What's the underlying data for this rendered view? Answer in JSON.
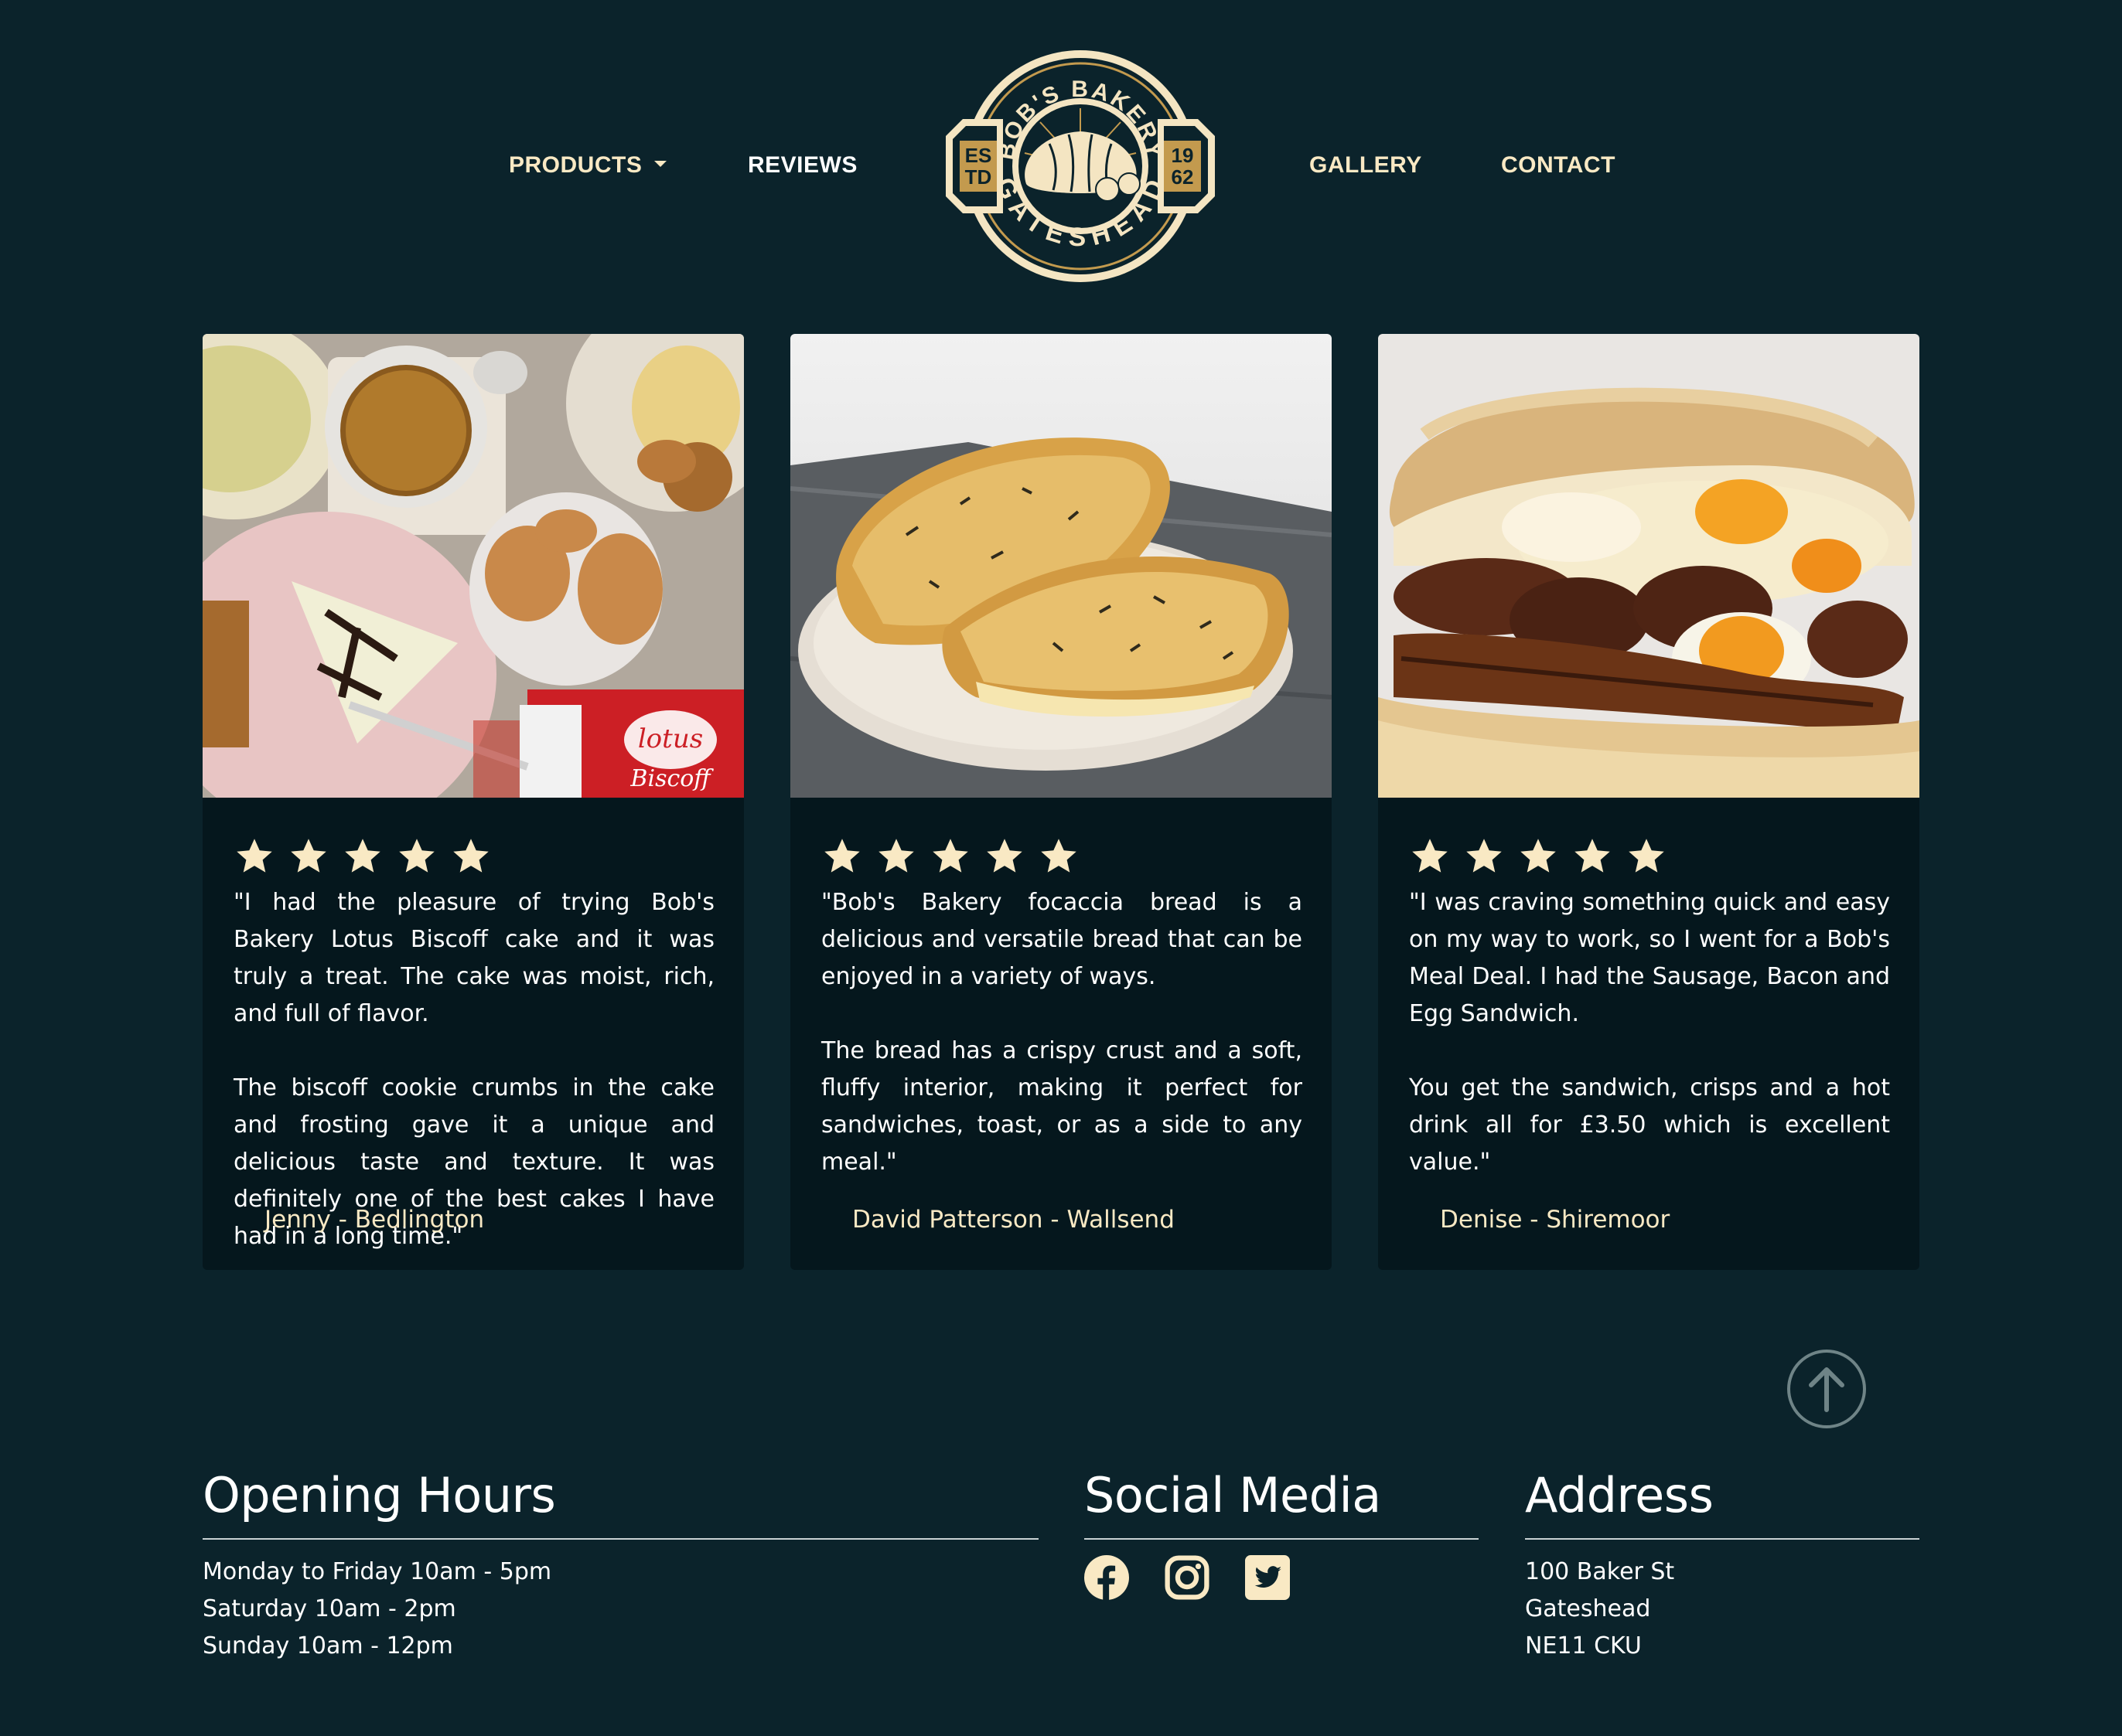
{
  "nav": {
    "products": "PRODUCTS",
    "reviews": "REVIEWS",
    "gallery": "GALLERY",
    "contact": "CONTACT"
  },
  "logo": {
    "top_text": "BOB'S BAKERY",
    "bottom_text": "GATESHEAD",
    "est_1": "ES",
    "est_2": "TD",
    "year_1": "19",
    "year_2": "62"
  },
  "reviews": [
    {
      "image": "lotus-biscoff-cake-photo",
      "rating": 5,
      "paragraphs": [
        "\"I had the pleasure of trying Bob's Bakery Lotus Biscoff cake and it was truly a treat. The cake was moist, rich, and full of flavor.",
        "The biscoff cookie crumbs in the cake and frosting gave it a unique and delicious taste and texture. It was definitely one of the best cakes I have had in a long time.\""
      ],
      "author": "Jenny - Bedlington"
    },
    {
      "image": "focaccia-bread-photo",
      "rating": 5,
      "paragraphs": [
        "\"Bob's Bakery focaccia bread is a delicious and versatile bread that can be enjoyed in a variety of ways.",
        "The bread has a crispy crust and a soft, fluffy interior, making it perfect for sandwiches, toast, or as a side to any meal.\""
      ],
      "author": "David Patterson - Wallsend"
    },
    {
      "image": "breakfast-sandwich-photo",
      "rating": 5,
      "paragraphs": [
        "\"I was craving something quick and easy on my way to work, so I went for a Bob's Meal Deal. I had the Sausage, Bacon and Egg Sandwich.",
        "You get the sandwich, crisps and a hot drink all for £3.50 which is excellent value.\""
      ],
      "author": "Denise - Shiremoor"
    }
  ],
  "footer": {
    "hours": {
      "title": "Opening Hours",
      "lines": [
        "Monday to Friday 10am - 5pm",
        "Saturday 10am - 2pm",
        "Sunday 10am - 12pm"
      ]
    },
    "social": {
      "title": "Social Media",
      "icons": [
        "facebook-icon",
        "instagram-icon",
        "twitter-icon"
      ]
    },
    "address": {
      "title": "Address",
      "lines": [
        "100 Baker St",
        "Gateshead",
        "NE11 CKU"
      ]
    }
  },
  "colors": {
    "background": "#0b232b",
    "card": "#05171d",
    "accent": "#f9e9c4",
    "logo_gold": "#c39a4e"
  }
}
